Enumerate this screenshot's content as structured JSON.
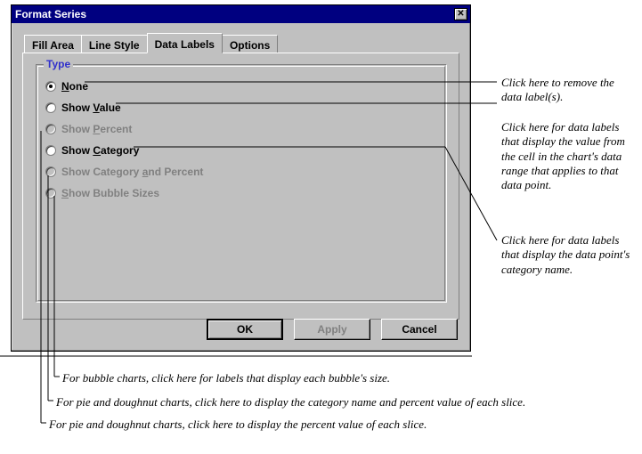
{
  "dialog": {
    "title": "Format Series"
  },
  "tabs": {
    "fill_area": "Fill Area",
    "line_style": "Line Style",
    "data_labels": "Data Labels",
    "options": "Options"
  },
  "group": {
    "title": "Type"
  },
  "radios": {
    "none_pre": "",
    "none_ul": "N",
    "none_post": "one",
    "show_value_pre": "Show ",
    "show_value_ul": "V",
    "show_value_post": "alue",
    "show_percent_pre": "Show ",
    "show_percent_ul": "P",
    "show_percent_post": "ercent",
    "show_category_pre": "Show ",
    "show_category_ul": "C",
    "show_category_post": "ategory",
    "show_cat_pct_pre": "Show Category ",
    "show_cat_pct_ul": "a",
    "show_cat_pct_post": "nd Percent",
    "show_bubble_pre": "",
    "show_bubble_ul": "S",
    "show_bubble_post": "how Bubble Sizes"
  },
  "buttons": {
    "ok": "OK",
    "apply": "Apply",
    "cancel": "Cancel"
  },
  "callouts": {
    "c1": "Click here to remove the data label(s).",
    "c2": "Click here for data labels that display the value from the cell in the chart's data range that applies to that data point.",
    "c3": "Click here for data labels that display the data point's category name.",
    "c4": "For bubble charts, click here for labels that display each bubble's size.",
    "c5": "For pie and doughnut charts, click here to display the category name and percent value of each slice.",
    "c6": "For pie and doughnut charts, click here to display the percent value of each slice."
  }
}
